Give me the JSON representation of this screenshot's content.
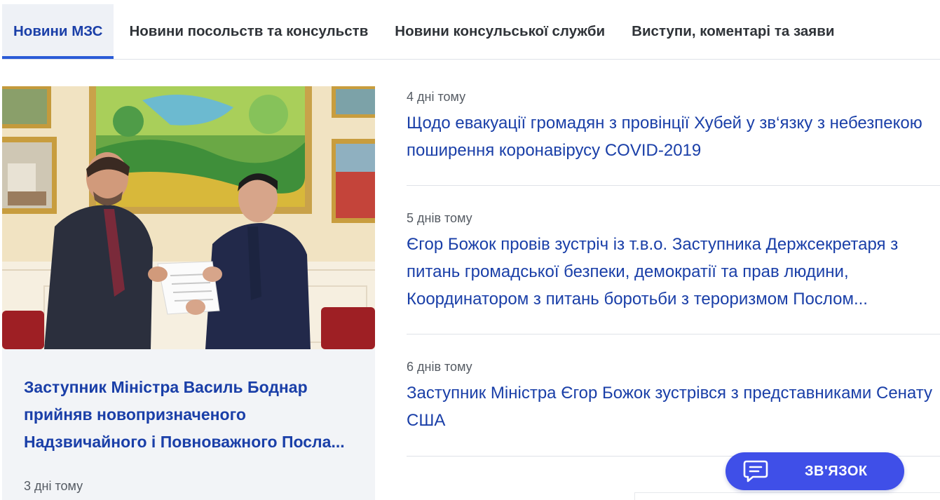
{
  "tabs": [
    {
      "label": "Новини МЗС",
      "active": true
    },
    {
      "label": "Новини посольств та консульств",
      "active": false
    },
    {
      "label": "Новини консульської служби",
      "active": false
    },
    {
      "label": "Виступи, коментарі та заяви",
      "active": false
    }
  ],
  "featured": {
    "title": "Заступник Міністра Василь Боднар прийняв новопризначеного Надзвичайного і Повноважного Посла...",
    "date": "3 дні тому"
  },
  "news": [
    {
      "date": "4 дні тому",
      "title": "Щодо евакуації громадян з провінції Хубей у зв‘язку з небезпекою поширення коронавірусу COVID-2019"
    },
    {
      "date": "5 днів тому",
      "title": "Єгор Божок провів зустріч із т.в.о. Заступника Держсекретаря з питань громадської безпеки, демократії та прав людини, Координатором з питань боротьби з тероризмом Послом..."
    },
    {
      "date": "6 днів тому",
      "title": "Заступник Міністра Єгор Божок зустрівся з представниками Сенату США"
    }
  ],
  "contact": {
    "label": "ЗВ'ЯЗОК",
    "icon": "chat-icon"
  },
  "colors": {
    "accent": "#1a3fa8",
    "button": "#3f4fe8",
    "tab_active_bg": "#eef1f6"
  }
}
